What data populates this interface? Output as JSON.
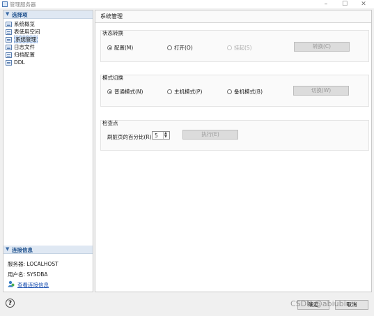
{
  "window": {
    "title": "管理服务器",
    "min": "–",
    "max": "☐",
    "close": "✕"
  },
  "nav": {
    "header": "选择项",
    "items": [
      {
        "label": "系统概览"
      },
      {
        "label": "表使用空间"
      },
      {
        "label": "系统管理",
        "selected": true
      },
      {
        "label": "日志文件"
      },
      {
        "label": "归档配置"
      },
      {
        "label": "DDL"
      }
    ]
  },
  "connection": {
    "header": "连接信息",
    "server": "服务器: LOCALHOST",
    "user": "用户名: SYSDBA",
    "link": "查看连接信息"
  },
  "main": {
    "title": "系统管理",
    "state": {
      "label": "状态转换",
      "options": [
        "配置(M)",
        "打开(O)",
        "挂起(S)"
      ],
      "selected": 0,
      "button": "转换(C)"
    },
    "mode": {
      "label": "模式切换",
      "options": [
        "普通模式(N)",
        "主机模式(P)",
        "备机模式(B)"
      ],
      "selected": 0,
      "button": "切换(W)"
    },
    "checkpoint": {
      "label": "检查点",
      "field_label": "刷脏页的百分比(R):",
      "value": "5",
      "button": "执行(E)"
    }
  },
  "footer": {
    "ok": "确定",
    "cancel": "取消",
    "watermark": "CSDN @abiubiu~"
  }
}
